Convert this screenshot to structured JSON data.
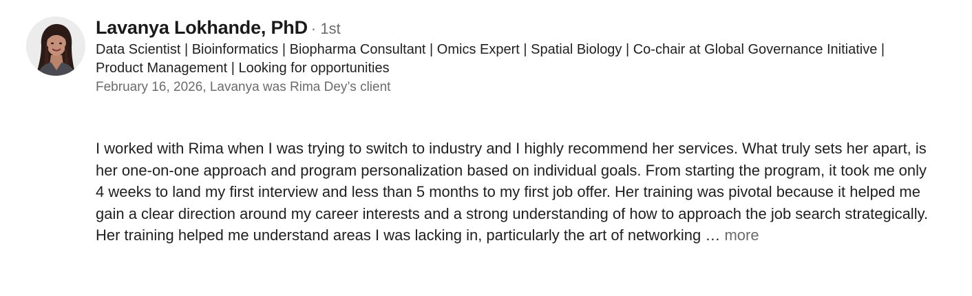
{
  "recommendation": {
    "author": {
      "name": "Lavanya Lokhande, PhD",
      "degree": "· 1st",
      "headline": "Data Scientist | Bioinformatics | Biopharma Consultant | Omics Expert | Spatial Biology | Co-chair at Global Governance Initiative | Product Management | Looking for opportunities",
      "meta": "February 16, 2026, Lavanya was Rima Dey’s client",
      "avatar_icon": "profile-photo"
    },
    "text": "I worked with Rima when I was trying to switch to industry and I highly recommend her services. What truly sets her apart, is her one-on-one approach and program personalization based on individual goals. From starting the program, it took me only 4 weeks to land my first interview and less than 5 months to my first job offer. Her training was pivotal because it helped me gain a clear direction around my career interests and a strong understanding of how to approach the job search strategically.  Her training helped me understand areas I was lacking in, particularly the art of networking … ",
    "more_label": "more"
  },
  "colors": {
    "text_primary": "#1f1f1f",
    "text_secondary": "#6b6b6b",
    "background": "#ffffff"
  }
}
